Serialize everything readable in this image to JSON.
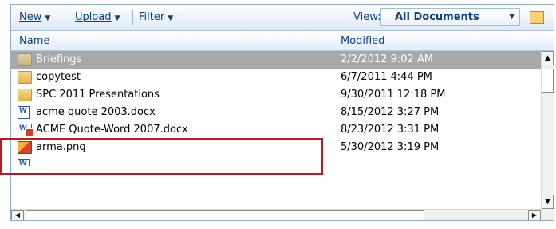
{
  "toolbar": {
    "new_label": "New",
    "upload_label": "Upload",
    "filter_label": "Filter",
    "view_label": "View:",
    "view_value": "All Documents"
  },
  "columns": {
    "name": "Name",
    "modified": "Modified"
  },
  "files": [
    {
      "name": "Briefings",
      "modified": "2/2/2012 9:02 AM",
      "icon": "folder-icon",
      "selected": true
    },
    {
      "name": "copytest",
      "modified": "6/7/2011 4:44 PM",
      "icon": "folder-icon"
    },
    {
      "name": "SPC 2011 Presentations",
      "modified": "9/30/2011 12:18 PM",
      "icon": "folder-icon"
    },
    {
      "name": "acme quote 2003.docx",
      "modified": "8/15/2012 3:27 PM",
      "icon": "word-doc-icon"
    },
    {
      "name": "ACME Quote-Word 2007.docx",
      "modified": "8/23/2012 3:31 PM",
      "icon": "word-doc-2007-icon",
      "highlighted": true
    },
    {
      "name": "arma.png",
      "modified": "5/30/2012 3:19 PM",
      "icon": "png-image-icon"
    },
    {
      "name": "...",
      "modified": "...",
      "icon": "file-icon"
    }
  ],
  "colors": {
    "highlight": "#b71c24",
    "selected_row": "#a8a8a8",
    "link": "#0b3f8a"
  }
}
